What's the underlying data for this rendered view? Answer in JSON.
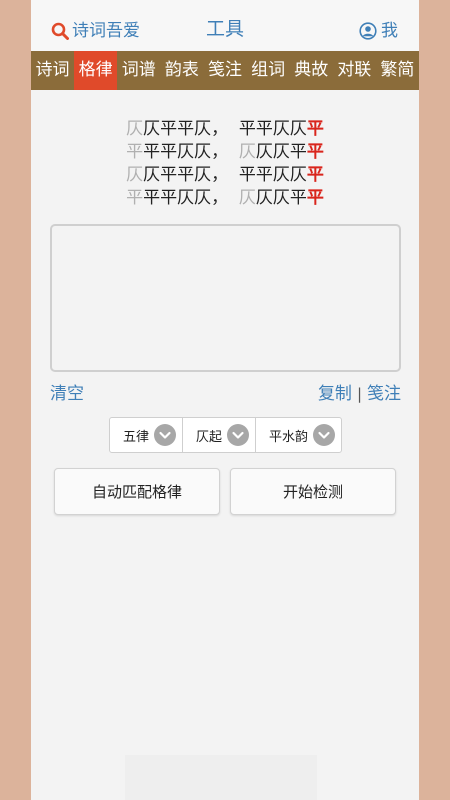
{
  "header": {
    "brand": "诗词吾爱",
    "title": "工具",
    "me": "我"
  },
  "nav": {
    "items": [
      "诗词",
      "格律",
      "词谱",
      "韵表",
      "笺注",
      "组词",
      "典故",
      "对联",
      "繁简"
    ],
    "active_index": 1
  },
  "pattern": {
    "lines": [
      [
        {
          "t": "仄",
          "c": "g"
        },
        {
          "t": "仄平平仄，  平平仄仄",
          "c": ""
        },
        {
          "t": "平",
          "c": "r"
        }
      ],
      [
        {
          "t": "平",
          "c": "g"
        },
        {
          "t": "平平仄仄，  ",
          "c": ""
        },
        {
          "t": "仄",
          "c": "g"
        },
        {
          "t": "仄仄平",
          "c": ""
        },
        {
          "t": "平",
          "c": "r"
        }
      ],
      [
        {
          "t": "仄",
          "c": "g"
        },
        {
          "t": "仄平平仄，  平平仄仄",
          "c": ""
        },
        {
          "t": "平",
          "c": "r"
        }
      ],
      [
        {
          "t": "平",
          "c": "g"
        },
        {
          "t": "平平仄仄，  ",
          "c": ""
        },
        {
          "t": "仄",
          "c": "g"
        },
        {
          "t": "仄仄平",
          "c": ""
        },
        {
          "t": "平",
          "c": "r"
        }
      ]
    ]
  },
  "input": {
    "value": "",
    "placeholder": ""
  },
  "links": {
    "clear": "清空",
    "copy": "复制",
    "separator": "|",
    "annotate": "笺注"
  },
  "selects": {
    "form": "五律",
    "start": "仄起",
    "rhyme": "平水韵"
  },
  "buttons": {
    "auto_match": "自动匹配格律",
    "start_check": "开始检测"
  },
  "colors": {
    "accent": "#3f7fb7",
    "nav_bg": "#8b6c3a",
    "nav_active": "#e04a2a",
    "rhyme_red": "#d9251c",
    "outer_bg": "#dcb39b"
  }
}
